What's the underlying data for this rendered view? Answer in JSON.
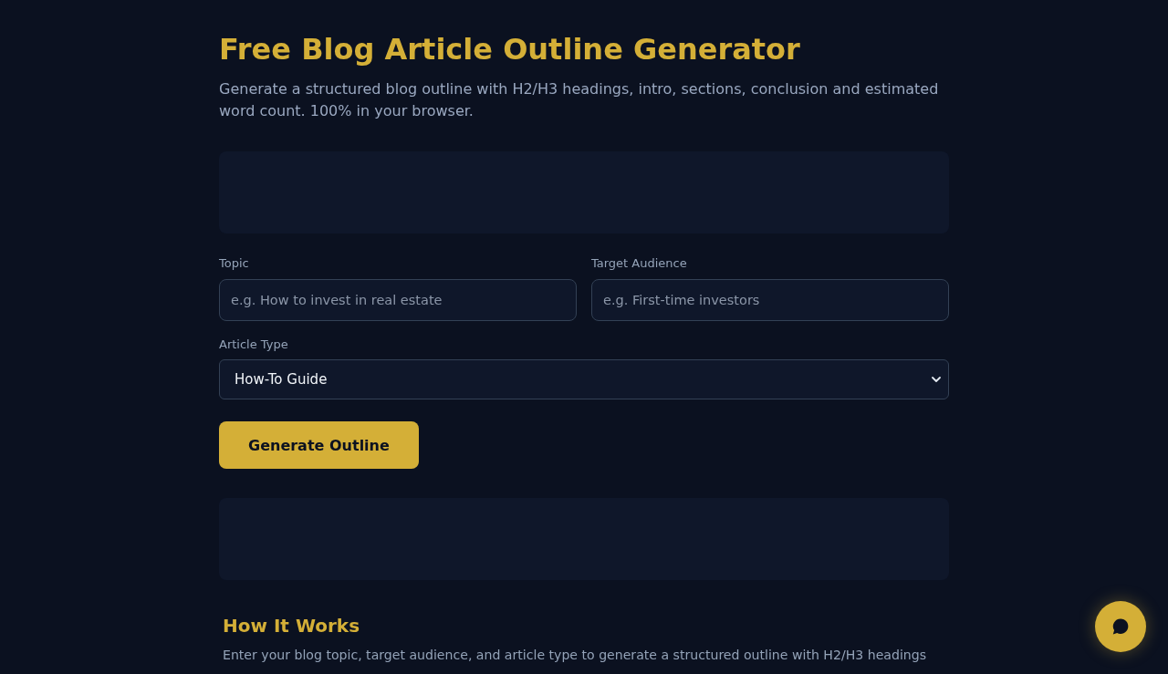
{
  "header": {
    "title": "Free Blog Article Outline Generator",
    "subtitle": "Generate a structured blog outline with H2/H3 headings, intro, sections, conclusion and estimated word count. 100% in your browser."
  },
  "form": {
    "fields": [
      {
        "label": "Topic",
        "placeholder": "e.g. How to invest in real estate"
      },
      {
        "label": "Target Audience",
        "placeholder": "e.g. First-time investors"
      }
    ],
    "article_type": {
      "label": "Article Type",
      "value": "How-To Guide"
    },
    "submit_button": "Generate Outline"
  },
  "how_it_works": {
    "heading": "How It Works",
    "text": "Enter your blog topic, target audience, and article type to generate a structured outline with H2/H3 headings"
  }
}
